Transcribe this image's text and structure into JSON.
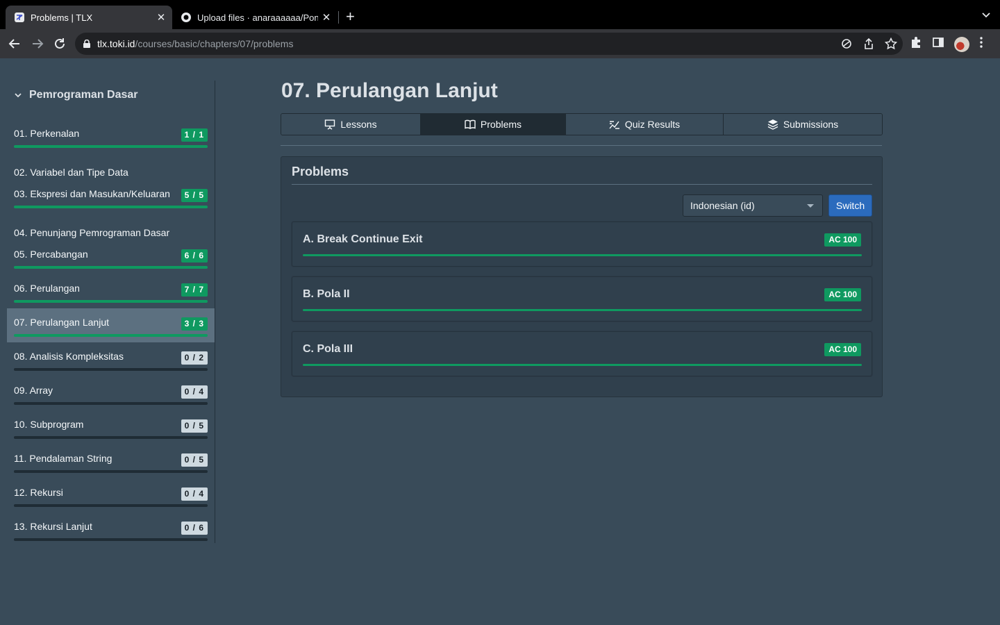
{
  "browser": {
    "tabs": [
      {
        "title": "Problems | TLX",
        "active": true
      },
      {
        "title": "Upload files · anaraaaaaa/Pond",
        "active": false
      }
    ],
    "url_host": "tlx.toki.id",
    "url_path": "/courses/basic/chapters/07/problems"
  },
  "sidebar": {
    "course_title": "Pemrograman Dasar",
    "chapters": [
      {
        "label": "01. Perkenalan",
        "badge": "1 / 1",
        "progress": 1.0
      },
      {
        "label": "02. Variabel dan Tipe Data"
      },
      {
        "label": "03. Ekspresi dan Masukan/Keluaran",
        "badge": "5 / 5",
        "progress": 1.0
      },
      {
        "label": "04. Penunjang Pemrograman Dasar"
      },
      {
        "label": "05. Percabangan",
        "badge": "6 / 6",
        "progress": 1.0
      },
      {
        "label": "06. Perulangan",
        "badge": "7 / 7",
        "progress": 1.0
      },
      {
        "label": "07. Perulangan Lanjut",
        "badge": "3 / 3",
        "progress": 1.0,
        "active": true
      },
      {
        "label": "08. Analisis Kompleksitas",
        "badge": "0 / 2",
        "progress": 0
      },
      {
        "label": "09. Array",
        "badge": "0 / 4",
        "progress": 0
      },
      {
        "label": "10. Subprogram",
        "badge": "0 / 5",
        "progress": 0
      },
      {
        "label": "11. Pendalaman String",
        "badge": "0 / 5",
        "progress": 0
      },
      {
        "label": "12. Rekursi",
        "badge": "0 / 4",
        "progress": 0
      },
      {
        "label": "13. Rekursi Lanjut",
        "badge": "0 / 6",
        "progress": 0
      }
    ]
  },
  "main": {
    "title": "07. Perulangan Lanjut",
    "tabs": [
      {
        "label": "Lessons",
        "icon": "presentation-icon"
      },
      {
        "label": "Problems",
        "icon": "book-icon",
        "selected": true
      },
      {
        "label": "Quiz Results",
        "icon": "chart-icon"
      },
      {
        "label": "Submissions",
        "icon": "layers-icon"
      }
    ],
    "card_title": "Problems",
    "language_select": "Indonesian (id)",
    "switch_label": "Switch",
    "problems": [
      {
        "name": "A. Break Continue Exit",
        "verdict": "AC 100",
        "progress": 1.0
      },
      {
        "name": "B. Pola II",
        "verdict": "AC 100",
        "progress": 1.0
      },
      {
        "name": "C. Pola III",
        "verdict": "AC 100",
        "progress": 1.0
      }
    ]
  },
  "colors": {
    "success": "#0f9960",
    "primary": "#2b6bbd",
    "background": "#394b59"
  }
}
